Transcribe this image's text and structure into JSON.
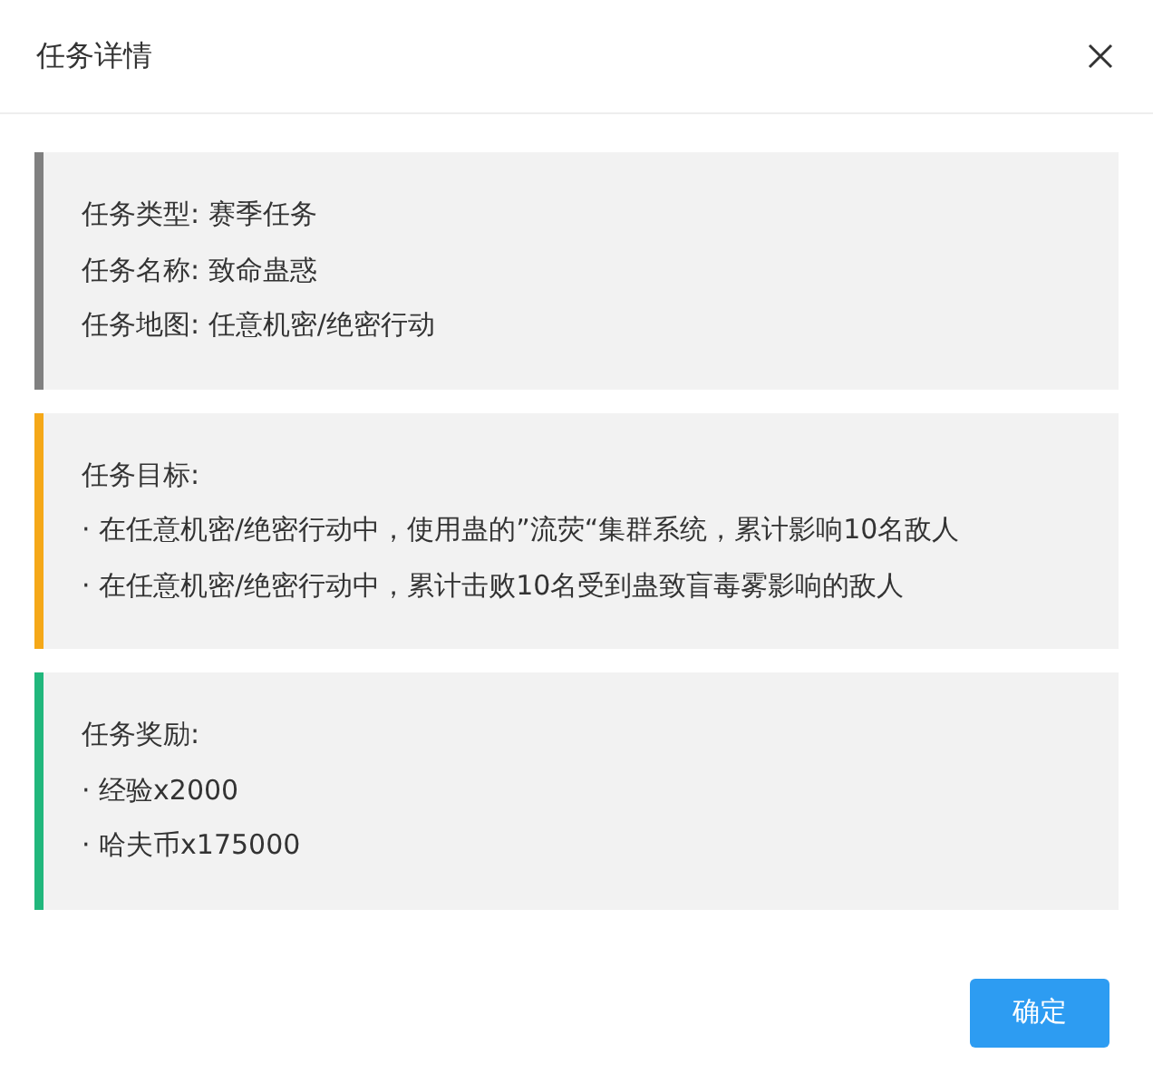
{
  "dialog": {
    "title": "任务详情"
  },
  "sections": [
    {
      "color": "#808080",
      "lines": [
        "任务类型: 赛季任务",
        "任务名称: 致命蛊惑",
        "任务地图: 任意机密/绝密行动"
      ]
    },
    {
      "color": "#f5a818",
      "lines": [
        "任务目标:",
        "· 在任意机密/绝密行动中，使用蛊的”流荧“集群系统，累计影响10名敌人",
        "· 在任意机密/绝密行动中，累计击败10名受到蛊致盲毒雾影响的敌人"
      ]
    },
    {
      "color": "#21b77c",
      "lines": [
        "任务奖励:",
        "· 经验x2000",
        "· 哈夫币x175000"
      ]
    }
  ],
  "buttons": [
    "确定"
  ]
}
